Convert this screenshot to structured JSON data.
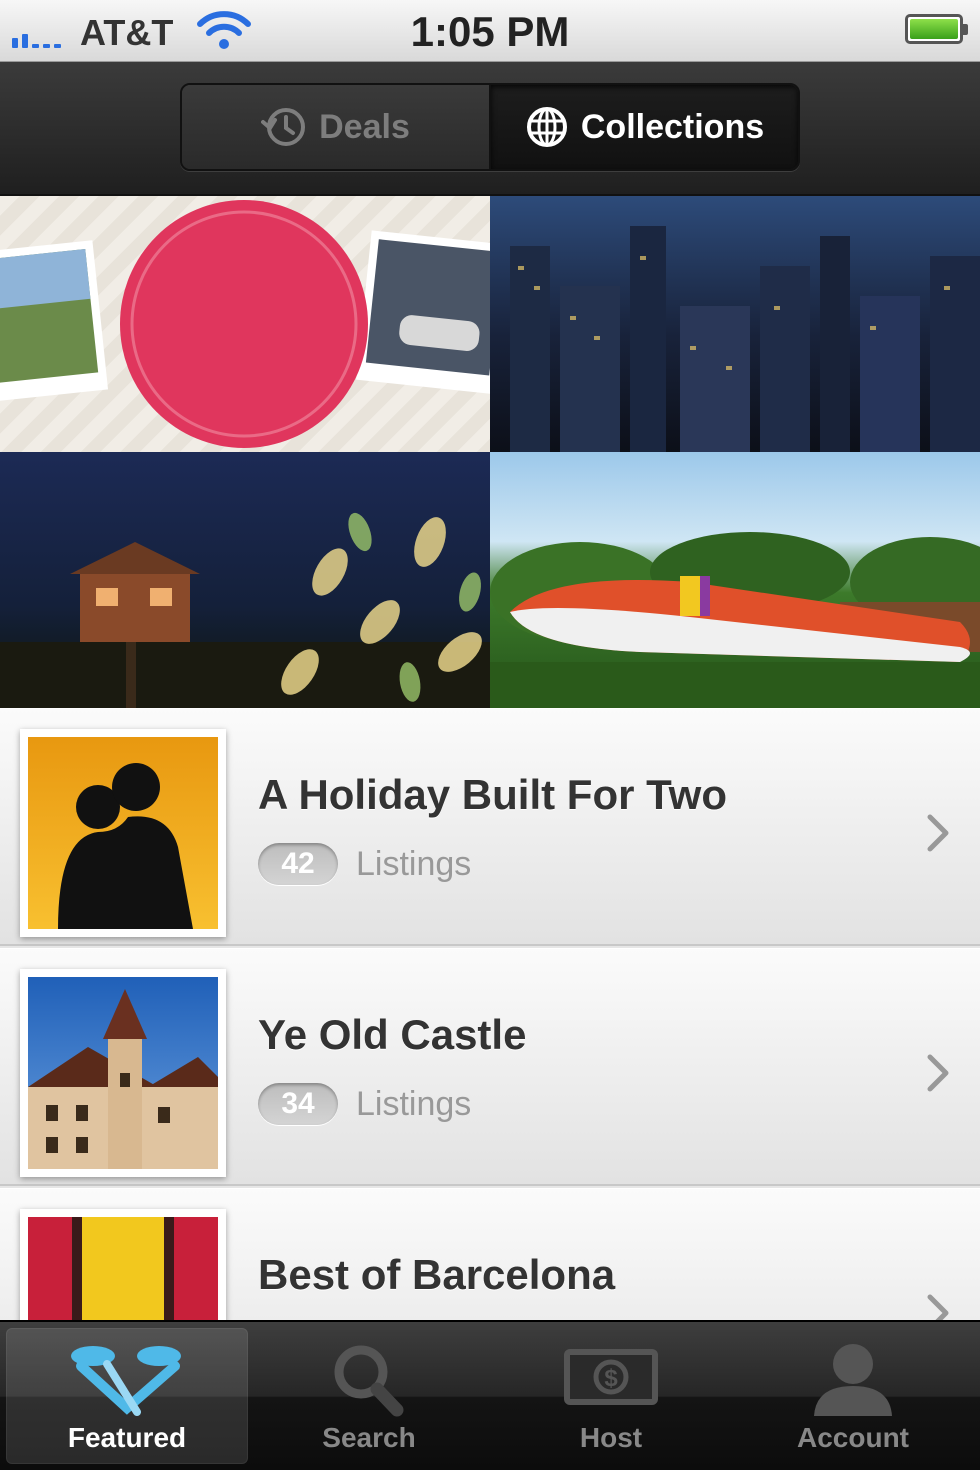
{
  "status_bar": {
    "carrier": "AT&T",
    "time": "1:05 PM"
  },
  "segmented_control": {
    "deals_label": "Deals",
    "collections_label": "Collections",
    "selected": "Collections"
  },
  "tiles": [
    {
      "name": "top-40",
      "icon": "top-40-collection"
    },
    {
      "name": "unique-new-york",
      "icon": "new-york-collection"
    },
    {
      "name": "trees-and-zzzs",
      "icon": "treehouse-collection"
    },
    {
      "name": "planes-trains-automobiles",
      "icon": "airplane-collection"
    }
  ],
  "collections": [
    {
      "title": "A Holiday Built For Two",
      "count": "42",
      "count_label": "Listings"
    },
    {
      "title": "Ye Old Castle",
      "count": "34",
      "count_label": "Listings"
    },
    {
      "title": "Best of Barcelona"
    }
  ],
  "tab_bar": {
    "featured_label": "Featured",
    "search_label": "Search",
    "host_label": "Host",
    "account_label": "Account",
    "selected": "Featured"
  },
  "colors": {
    "signal": "#2a6ee0",
    "battery": "#3aa01a",
    "top40_circle": "#e0365d",
    "tab_active_icon": "#4fb9e8"
  }
}
